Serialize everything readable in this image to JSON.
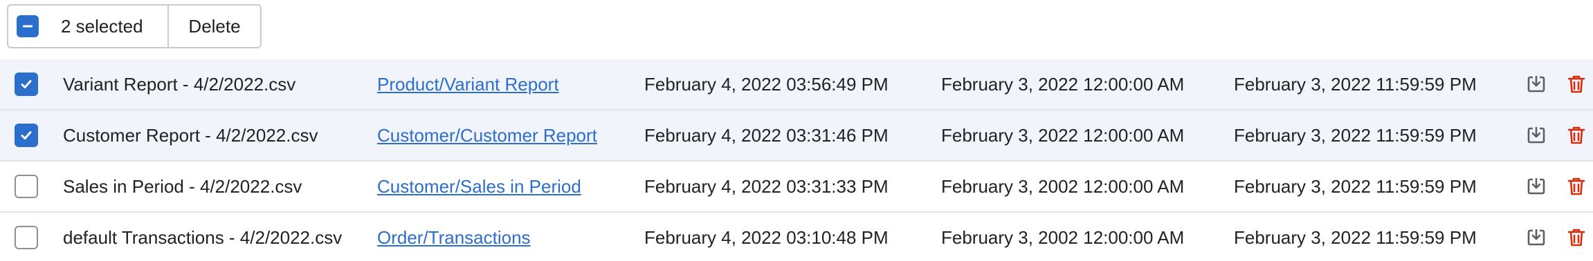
{
  "bulk_actions": {
    "selected_label": "2 selected",
    "delete_label": "Delete"
  },
  "colors": {
    "accent": "#2c6ecb",
    "selected_row_bg": "#f1f5fb",
    "delete_icon": "#d82c0d",
    "download_icon": "#5c5f62"
  },
  "icons": {
    "download": "download-icon",
    "delete": "trash-icon",
    "check": "checkmark-icon",
    "indeterminate": "minus-icon"
  },
  "rows": [
    {
      "checked": true,
      "name": "Variant Report - 4/2/2022.csv",
      "type": "Product/Variant Report",
      "created": "February 4, 2022 03:56:49 PM",
      "start": "February 3, 2022 12:00:00 AM",
      "end": "February 3, 2022 11:59:59 PM"
    },
    {
      "checked": true,
      "name": "Customer Report - 4/2/2022.csv",
      "type": "Customer/Customer Report",
      "created": "February 4, 2022 03:31:46 PM",
      "start": "February 3, 2022 12:00:00 AM",
      "end": "February 3, 2022 11:59:59 PM"
    },
    {
      "checked": false,
      "name": "Sales in Period - 4/2/2022.csv",
      "type": "Customer/Sales in Period",
      "created": "February 4, 2022 03:31:33 PM",
      "start": "February 3, 2002 12:00:00 AM",
      "end": "February 3, 2022 11:59:59 PM"
    },
    {
      "checked": false,
      "name": "default Transactions - 4/2/2022.csv",
      "type": "Order/Transactions",
      "created": "February 4, 2022 03:10:48 PM",
      "start": "February 3, 2002 12:00:00 AM",
      "end": "February 3, 2022 11:59:59 PM"
    }
  ]
}
